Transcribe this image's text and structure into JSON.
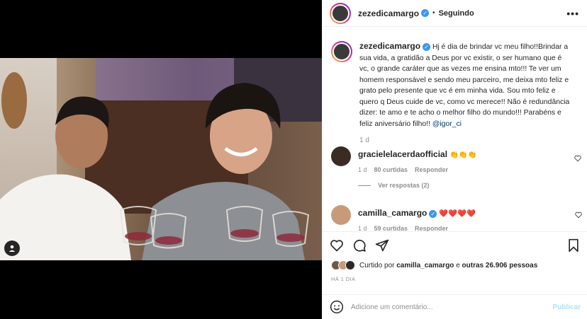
{
  "header": {
    "username": "zezedicamargo",
    "separator": "•",
    "follow_state": "Seguindo",
    "more_icon": "more-horizontal-icon"
  },
  "caption": {
    "username": "zezedicamargo",
    "text": "Hj é dia de brindar vc meu filho!!Brindar a sua vida, a gratidão a Deus por vc existir, o ser humano que é vc, o grande caráter que as vezes me ensina mto!!! Te ver um homem responsável e sendo meu parceiro, me deixa mto feliz e grato pelo presente que vc é em minha vida. Sou mto feliz e quero q Deus cuide de vc, como vc merece!! Não é redundância dizer: te amo e te acho o melhor filho do mundo!!! Parabéns e feliz aniversário filho!!",
    "mention": "@igor_ci",
    "age": "1 d"
  },
  "comments": [
    {
      "username": "gracielelacerdaofficial",
      "text": "👏👏👏",
      "age": "1 d",
      "likes": "80 curtidas",
      "reply": "Responder",
      "view_replies": "Ver respostas (2)"
    },
    {
      "username": "camilla_camargo",
      "text": "❤️❤️❤️❤️",
      "age": "1 d",
      "likes": "59 curtidas",
      "reply": "Responder"
    }
  ],
  "likes": {
    "prefix": "Curtido por",
    "user": "camilla_camargo",
    "middle": "e",
    "others": "outras 26.906 pessoas"
  },
  "post_age": "HÁ 1 DIA",
  "comment_input": {
    "placeholder": "Adicione um comentário...",
    "submit": "Publicar"
  }
}
